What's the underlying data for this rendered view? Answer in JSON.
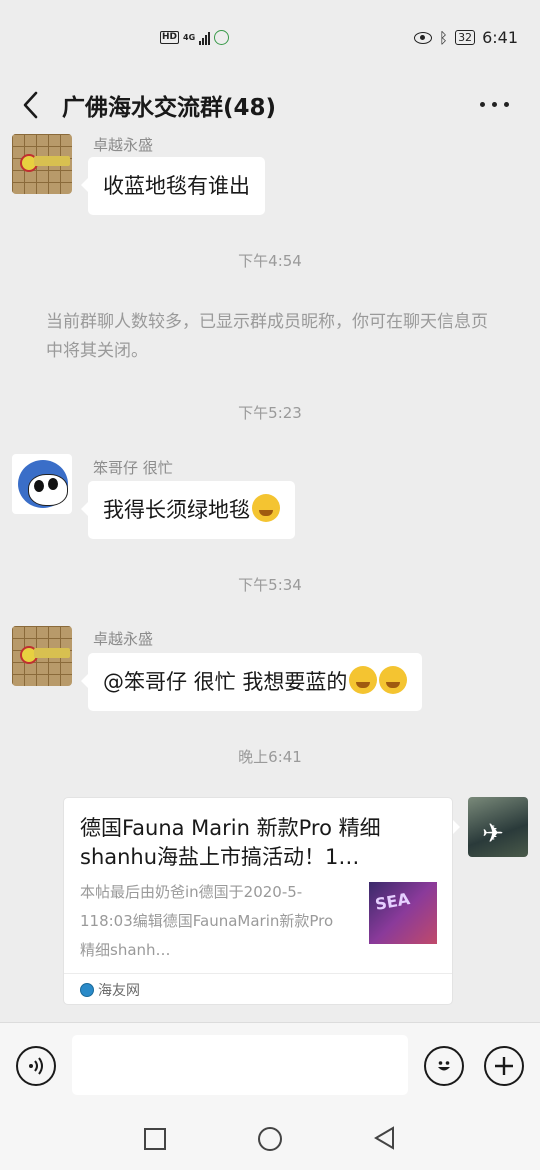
{
  "status_bar": {
    "network": "HD",
    "network_type": "4G",
    "battery": "32",
    "time": "6:41"
  },
  "header": {
    "title": "广佛海水交流群(48)"
  },
  "messages": [
    {
      "sender": "卓越永盛",
      "text": "收蓝地毯有谁出"
    },
    {
      "time": "下午4:54"
    },
    {
      "system": "当前群聊人数较多，已显示群成员昵称，你可在聊天信息页中将其关闭。"
    },
    {
      "time": "下午5:23"
    },
    {
      "sender": "笨哥仔 很忙",
      "text": "我得长须绿地毯"
    },
    {
      "time": "下午5:34"
    },
    {
      "sender": "卓越永盛",
      "text": "@笨哥仔 很忙  我想要蓝的"
    },
    {
      "time": "晚上6:41"
    }
  ],
  "link_card": {
    "title": "德国Fauna Marin 新款Pro 精细shanhu海盐上市搞活动！1…",
    "description": "本帖最后由奶爸in德国于2020-5-118:03编辑德国FaunaMarin新款Pro精细shanh…",
    "source": "海友网",
    "thumb_text": "SEA"
  },
  "icons": {
    "back": "chevron-left-icon",
    "more": "more-dots-icon",
    "voice": "voice-icon",
    "emoji": "emoji-icon",
    "plus": "plus-icon"
  }
}
